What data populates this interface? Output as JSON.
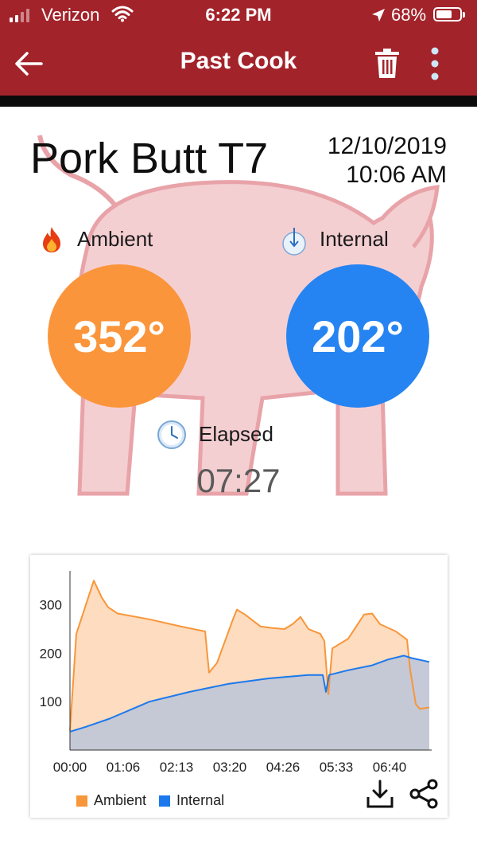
{
  "status_bar": {
    "carrier": "Verizon",
    "time": "6:22 PM",
    "battery": "68%",
    "battery_level": 0.68,
    "icons": [
      "signal-icon",
      "wifi-icon",
      "location-icon",
      "battery-icon"
    ]
  },
  "app_bar": {
    "title": "Past Cook",
    "icons": [
      "back-arrow-icon",
      "trash-icon",
      "more-vertical-icon"
    ]
  },
  "cook": {
    "name": "Pork Butt T7",
    "date": "12/10/2019",
    "time": "10:06 AM"
  },
  "ambient": {
    "label": "Ambient",
    "value": "352°",
    "icon": "flame-icon",
    "color": "#fb953b"
  },
  "internal": {
    "label": "Internal",
    "value": "202°",
    "icon": "probe-icon",
    "color": "#2584f1"
  },
  "elapsed": {
    "label": "Elapsed",
    "value": "07:27",
    "icon": "clock-icon"
  },
  "chart_data": {
    "type": "area",
    "x_tick_labels": [
      "00:00",
      "01:06",
      "02:13",
      "03:20",
      "04:26",
      "05:33",
      "06:40"
    ],
    "y_tick_labels": [
      "100",
      "200",
      "300"
    ],
    "ylim": [
      0,
      370
    ],
    "grid": false,
    "legend_placement": "bottom-left",
    "series": [
      {
        "name": "Ambient",
        "color": "#f8963a",
        "fill": "#fddcbf",
        "points": [
          [
            0,
            40
          ],
          [
            8,
            240
          ],
          [
            30,
            350
          ],
          [
            40,
            315
          ],
          [
            48,
            295
          ],
          [
            60,
            282
          ],
          [
            100,
            270
          ],
          [
            140,
            255
          ],
          [
            170,
            245
          ],
          [
            175,
            160
          ],
          [
            185,
            180
          ],
          [
            205,
            270
          ],
          [
            210,
            290
          ],
          [
            220,
            280
          ],
          [
            240,
            255
          ],
          [
            255,
            252
          ],
          [
            270,
            250
          ],
          [
            280,
            260
          ],
          [
            290,
            275
          ],
          [
            300,
            250
          ],
          [
            315,
            240
          ],
          [
            320,
            225
          ],
          [
            325,
            115
          ],
          [
            330,
            210
          ],
          [
            350,
            230
          ],
          [
            360,
            255
          ],
          [
            370,
            280
          ],
          [
            380,
            282
          ],
          [
            390,
            260
          ],
          [
            410,
            245
          ],
          [
            424,
            228
          ],
          [
            428,
            165
          ],
          [
            435,
            95
          ],
          [
            440,
            85
          ],
          [
            452,
            88
          ]
        ]
      },
      {
        "name": "Internal",
        "color": "#1b79ec",
        "fill": "#c2c6d6",
        "points": [
          [
            0,
            38
          ],
          [
            20,
            48
          ],
          [
            50,
            65
          ],
          [
            100,
            100
          ],
          [
            150,
            120
          ],
          [
            200,
            137
          ],
          [
            250,
            148
          ],
          [
            300,
            155
          ],
          [
            318,
            155
          ],
          [
            322,
            120
          ],
          [
            326,
            155
          ],
          [
            350,
            165
          ],
          [
            380,
            175
          ],
          [
            400,
            187
          ],
          [
            420,
            195
          ],
          [
            430,
            190
          ],
          [
            452,
            182
          ]
        ]
      }
    ]
  }
}
